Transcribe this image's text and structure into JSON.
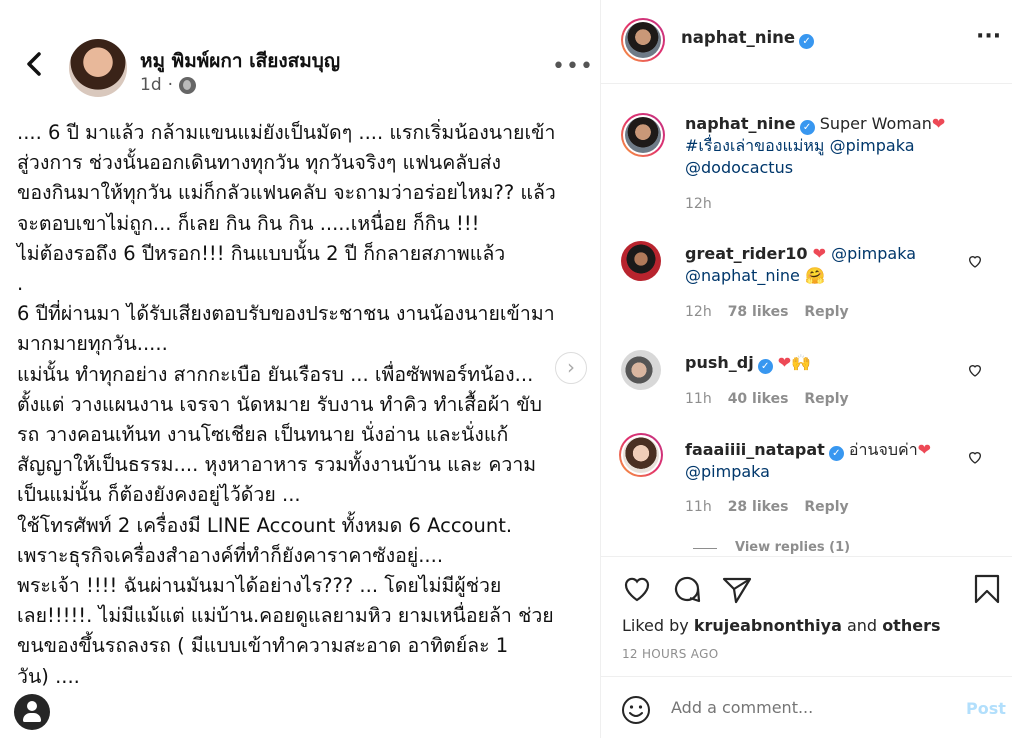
{
  "fb_post": {
    "author": "หมู พิมพ์ผกา เสียงสมบุญ",
    "time": "1d",
    "lines": [
      ".... 6 ปี มาแล้ว กล้ามแขนแม่ยังเป็นมัดๆ .... แรกเริ่มน้องนายเข้า",
      "สู่วงการ ช่วงนั้นออกเดินทางทุกวัน ทุกวันจริงๆ แฟนคลับส่ง",
      "ของกินมาให้ทุกวัน แม่ก็กลัวแฟนคลับ จะถามว่าอร่อยไหม?? แล้ว",
      "จะตอบเขาไม่ถูก... ก็เลย กิน กิน กิน .....เหนื่อย ก็กิน !!!",
      "ไม่ต้องรอถึง 6 ปีหรอก!!!  กินแบบนั้น 2 ปี ก็กลายสภาพแล้ว",
      ".",
      "6 ปีที่ผ่านมา ได้รับเสียงตอบรับของประชาชน งานน้องนายเข้ามา",
      "มากมายทุกวัน.....",
      "แม่นั้น ทำทุกอย่าง สากกะเบือ ยันเรือรบ ... เพื่อซัพพอร์ทน้อง...",
      "ตั้งแต่ วางแผนงาน เจรจา นัดหมาย รับงาน ทำคิว ทำเสื้อผ้า  ขับ",
      "รถ วางคอนเท้นท งานโซเชียล เป็นทนาย นั่งอ่าน และนั่งแก้",
      "สัญญาให้เป็นธรรม.... หุงหาอาหาร  รวมทั้งงานบ้าน  และ ความ",
      "เป็นแม่นั้น  ก็ต้องยังคงอยู่ไว้ด้วย ...",
      "ใช้โทรศัพท์ 2 เครื่องมี LINE Account ทั้งหมด 6  Account.",
      "เพราะธุรกิจเครื่องสำอางค์ที่ทำก็ยังคาราคาซังอยู่....",
      "พระเจ้า !!!! ฉันผ่านมันมาได้อย่างไร???  ... โดยไม่มีผู้ช่วย",
      "เลย!!!!!. ไม่มีแม้แต่ แม่บ้าน.คอยดูแลยามหิว ยามเหนื่อยล้า ช่วย",
      "ขนของขึ้นรถลงรถ ( มีแบบเข้าทำความสะอาด อาทิตย์ละ 1",
      "วัน) ...."
    ]
  },
  "header": {
    "username": "naphat_nine"
  },
  "caption": {
    "username": "naphat_nine",
    "text": "Super Woman",
    "hashtag": "#เรื่องเล่าของแม่หมู",
    "mention1": "@pimpaka",
    "mention2": "@dodocactus",
    "time": "12h"
  },
  "comments": [
    {
      "username": "great_rider10",
      "mention1": "@pimpaka",
      "mention2": "@naphat_nine",
      "emoji": "🤗",
      "time": "12h",
      "likes": "78 likes",
      "reply": "Reply"
    },
    {
      "username": "push_dj",
      "emoji": "🙌",
      "time": "11h",
      "likes": "40 likes",
      "reply": "Reply"
    },
    {
      "username": "faaaiiii_natapat",
      "text": "อ่านจบค่า",
      "mention": "@pimpaka",
      "time": "11h",
      "likes": "28 likes",
      "reply": "Reply"
    }
  ],
  "view_replies": "View replies (1)",
  "liked_by": {
    "prefix": "Liked by",
    "user": "krujeabnonthiya",
    "mid": "and",
    "others": "others"
  },
  "posted_ago": "12 HOURS AGO",
  "add_comment": {
    "placeholder": "Add a comment...",
    "post_label": "Post"
  },
  "colors": {
    "verified": "#3897f0",
    "heart": "#ed4956",
    "link": "#00376b",
    "post_disabled": "#b2dffc"
  }
}
